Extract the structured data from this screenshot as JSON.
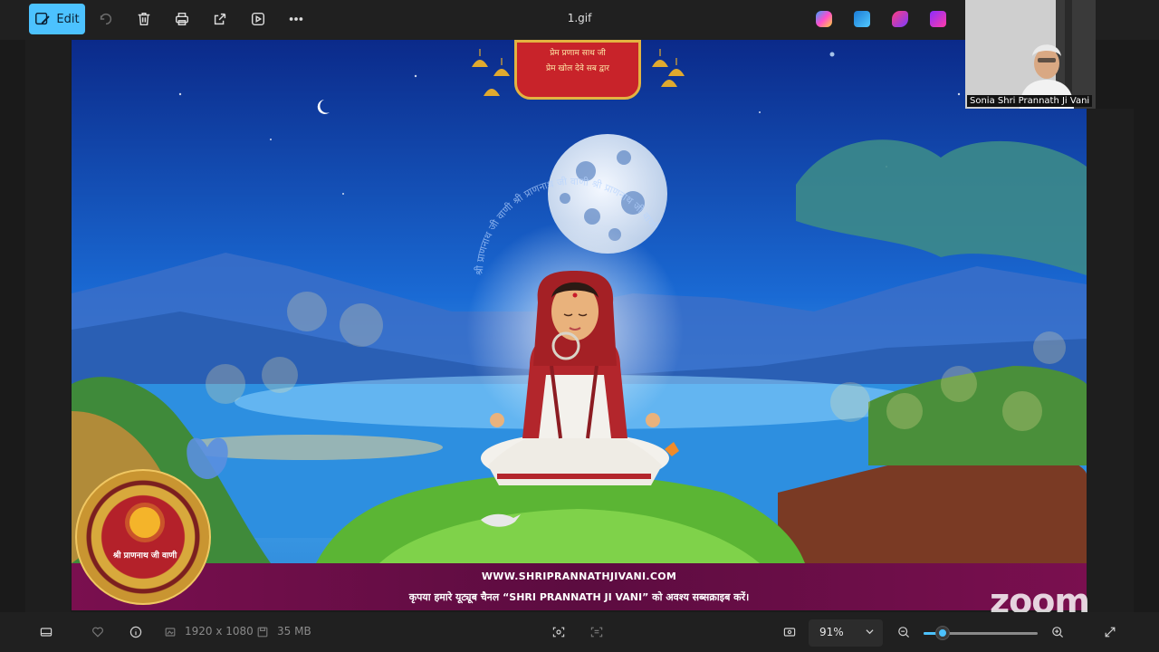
{
  "toolbar": {
    "edit_label": "Edit",
    "file_title": "1.gif",
    "accent_color": "#4cc2ff"
  },
  "image": {
    "banner_line1": "प्रेम प्रणाम साथ जी",
    "banner_line2": "प्रेम खोल देवे सब द्वार",
    "footer_url": "WWW.SHRIPRANNATHJIVANI.COM",
    "footer_message": "कृपया हमारे यूट्यूब चैनल “SHRI PRANNATH JI VANI” को अवश्य सब्सक्राइब करें।",
    "logo_text": "श्री प्राणनाथ जी वाणी",
    "circular_text": "श्री प्राणनाथ जी वाणी श्री प्राणनाथ जी वाणी श्री प्राणनाथ जी वाणी"
  },
  "webcam": {
    "participant_name": "Sonia  Shri Prannath Ji Vani"
  },
  "watermark": "zoom",
  "statusbar": {
    "dimensions": "1920 x 1080",
    "file_size": "35 MB",
    "zoom_level": "91%",
    "zoom_slider_fraction": 0.17
  }
}
